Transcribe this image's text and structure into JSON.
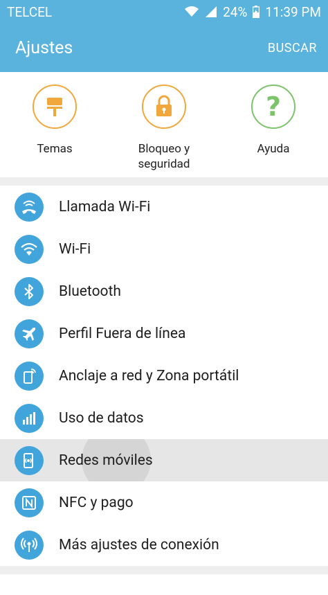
{
  "status": {
    "carrier": "TELCEL",
    "battery": "24%",
    "time": "11:39 PM"
  },
  "appbar": {
    "title": "Ajustes",
    "search": "BUSCAR"
  },
  "quick": [
    {
      "label": "Temas",
      "icon": "paint-roller-icon"
    },
    {
      "label": "Bloqueo y seguridad",
      "icon": "lock-icon"
    },
    {
      "label": "Ayuda",
      "icon": "help-question-icon"
    }
  ],
  "settings": [
    {
      "label": "Llamada Wi-Fi",
      "icon": "wifi-calling-icon"
    },
    {
      "label": "Wi-Fi",
      "icon": "wifi-icon"
    },
    {
      "label": "Bluetooth",
      "icon": "bluetooth-icon"
    },
    {
      "label": "Perfil Fuera de línea",
      "icon": "airplane-icon"
    },
    {
      "label": "Anclaje a red y Zona portátil",
      "icon": "hotspot-icon"
    },
    {
      "label": "Uso de datos",
      "icon": "data-usage-icon"
    },
    {
      "label": "Redes móviles",
      "icon": "mobile-networks-icon"
    },
    {
      "label": "NFC y pago",
      "icon": "nfc-icon"
    },
    {
      "label": "Más ajustes de conexión",
      "icon": "more-connection-icon"
    }
  ],
  "colors": {
    "accent": "#5ab3dc",
    "icon_blue": "#41a5dc",
    "orange": "#f0a83c",
    "green": "#7dc36b"
  }
}
